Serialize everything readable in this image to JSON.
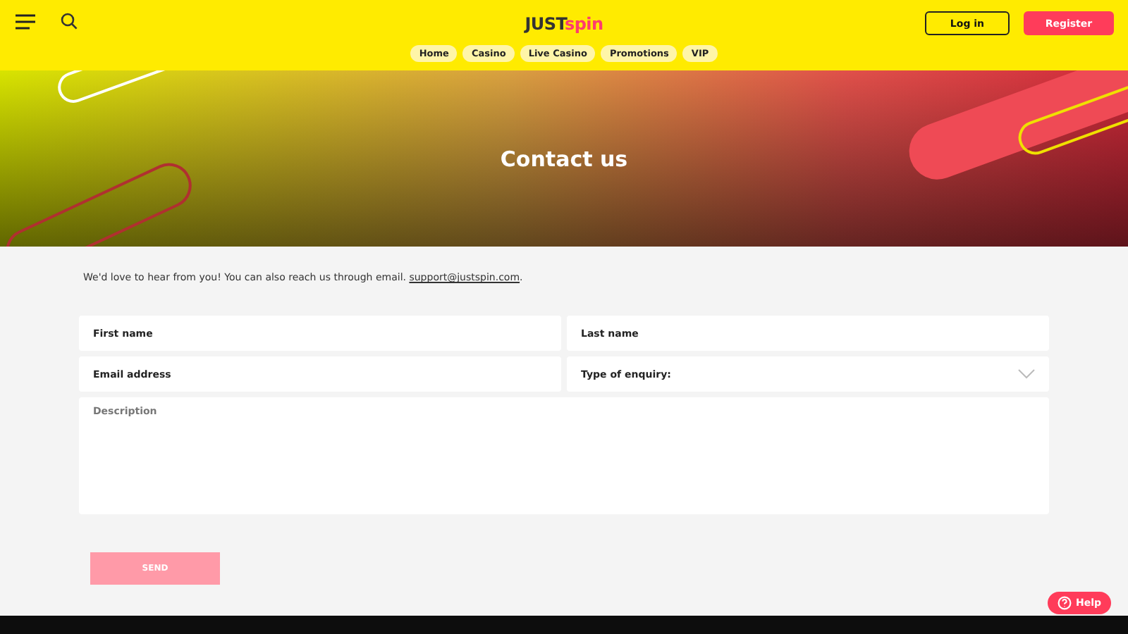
{
  "header": {
    "logo": {
      "part_1": "JUST",
      "part_2": "spin"
    },
    "login": "Log in",
    "register": "Register"
  },
  "nav": [
    "Home",
    "Casino",
    "Live Casino",
    "Promotions",
    "VIP"
  ],
  "hero": {
    "title": "Contact us"
  },
  "intro": {
    "text": "We'd love to hear from you! You can also reach us through email. ",
    "link": "support@justspin.com",
    "after": "."
  },
  "form": {
    "fields": [
      {
        "kind": "input",
        "placeholder": "First name"
      },
      {
        "kind": "input",
        "placeholder": "Last name"
      },
      {
        "kind": "input",
        "placeholder": "Email address"
      },
      {
        "kind": "select",
        "placeholder": "Type of enquiry:"
      },
      {
        "kind": "textarea",
        "placeholder": "Description"
      }
    ],
    "submit": {
      "label": "SEND",
      "disabled": true
    }
  },
  "help": {
    "label": "Help"
  }
}
